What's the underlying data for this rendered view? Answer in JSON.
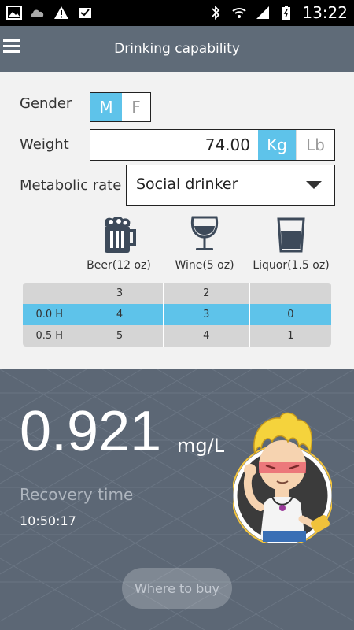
{
  "status_bar": {
    "time": "13:22",
    "left_icons": [
      "image-icon",
      "cloud-icon",
      "warning-icon",
      "inbox-icon"
    ],
    "right_icons": [
      "bluetooth-icon",
      "wifi-icon",
      "signal-icon",
      "battery-icon"
    ]
  },
  "app_bar": {
    "title": "Drinking capability",
    "menu_icon": "hamburger-menu-icon"
  },
  "form": {
    "gender_label": "Gender",
    "gender_options": [
      "M",
      "F"
    ],
    "gender_selected": "M",
    "weight_label": "Weight",
    "weight_value": "74.00",
    "weight_units": [
      "Kg",
      "Lb"
    ],
    "weight_unit_selected": "Kg",
    "metabolic_label": "Metabolic rate",
    "metabolic_value": "Social drinker"
  },
  "drinks": [
    {
      "label": "Beer(12 oz)",
      "icon": "beer-mug-icon"
    },
    {
      "label": "Wine(5 oz)",
      "icon": "wine-glass-icon"
    },
    {
      "label": "Liquor(1.5 oz)",
      "icon": "liquor-glass-icon"
    }
  ],
  "table": {
    "rows": [
      [
        "",
        "3",
        "2",
        ""
      ],
      [
        "0.0 H",
        "4",
        "3",
        "0"
      ],
      [
        "0.5 H",
        "5",
        "4",
        "1"
      ]
    ]
  },
  "result": {
    "bac_value": "0.921",
    "bac_unit": "mg/L",
    "recovery_label": "Recovery time",
    "recovery_time": "10:50:17",
    "buy_button": "Where to buy"
  },
  "colors": {
    "accent": "#5ec3ea",
    "app_bar": "#5f6b78",
    "bottom_bg": "#5c6775"
  }
}
